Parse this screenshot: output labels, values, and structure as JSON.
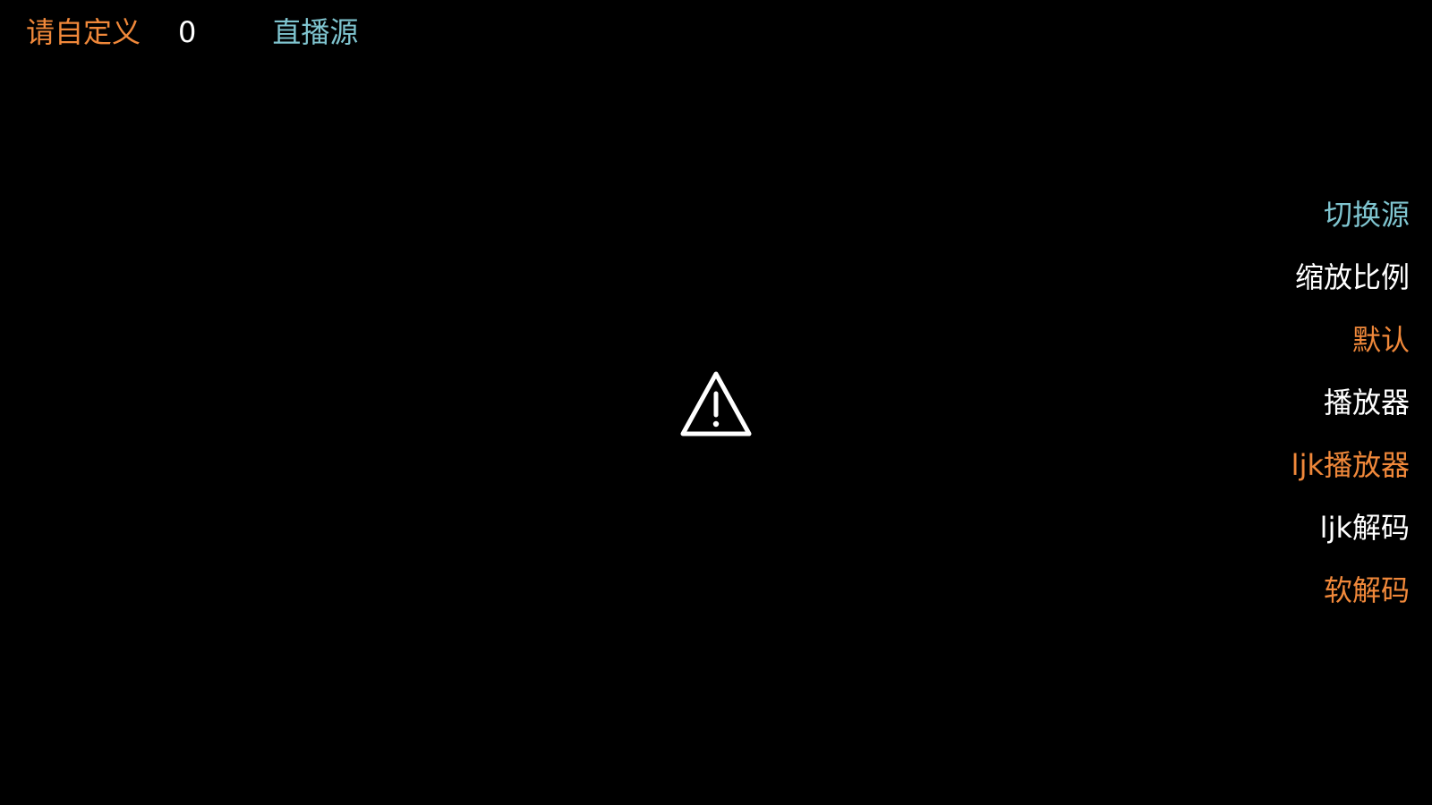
{
  "top_bar": {
    "channel_name": "请自定义",
    "channel_number": "0",
    "source_type": "直播源"
  },
  "center": {
    "icon": "warning-icon"
  },
  "side_menu": {
    "switch_source": "切换源",
    "scale_ratio_label": "缩放比例",
    "scale_ratio_value": "默认",
    "player_label": "播放器",
    "player_value": "ljk播放器",
    "decoder_label": "ljk解码",
    "decoder_value": "软解码"
  },
  "colors": {
    "background": "#000000",
    "accent_orange": "#f0883a",
    "accent_cyan": "#7fc4cf",
    "text_white": "#ffffff"
  }
}
